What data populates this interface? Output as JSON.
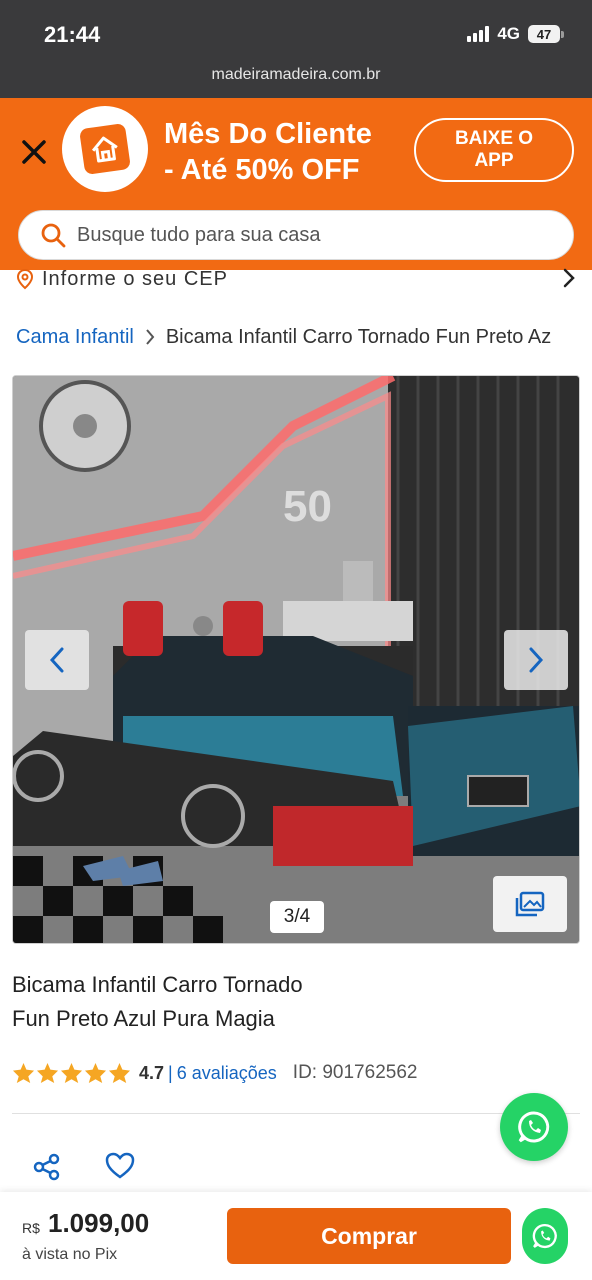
{
  "status_bar": {
    "time": "21:44",
    "network": "4G",
    "battery": "47"
  },
  "browser": {
    "url": "madeiramadeira.com.br"
  },
  "banner": {
    "line1": "Mês Do Cliente",
    "line2": "- Até 50% OFF",
    "app_button_line1": "BAIXE O",
    "app_button_line2": "APP"
  },
  "search": {
    "placeholder": "Busque tudo para sua casa"
  },
  "cep": {
    "label": "Informe o seu CEP"
  },
  "breadcrumb": {
    "parent": "Cama Infantil",
    "current": "Bicama Infantil Carro Tornado Fun Preto Az"
  },
  "gallery": {
    "counter": "3/4"
  },
  "product": {
    "title_line1": "Bicama Infantil Carro Tornado",
    "title_line2": "Fun Preto Azul Pura Magia",
    "rating": "4.7",
    "reviews_separator": "|",
    "reviews_label": "6 avaliações",
    "id_label": "ID: 901762562"
  },
  "purchase": {
    "currency": "R$",
    "price": "1.099,00",
    "note": "à vista no Pix",
    "buy_label": "Comprar"
  },
  "colors": {
    "brand_orange": "#f26a13",
    "button_orange": "#e8620f",
    "link_blue": "#1565c0",
    "whatsapp_green": "#25d366",
    "star": "#f5a623"
  },
  "icons": [
    "close-icon",
    "brand-logo-icon",
    "search-icon",
    "location-pin-icon",
    "chevron-right-icon",
    "chevron-left-icon",
    "gallery-icon",
    "star-icon",
    "whatsapp-icon",
    "share-icon",
    "heart-icon"
  ]
}
